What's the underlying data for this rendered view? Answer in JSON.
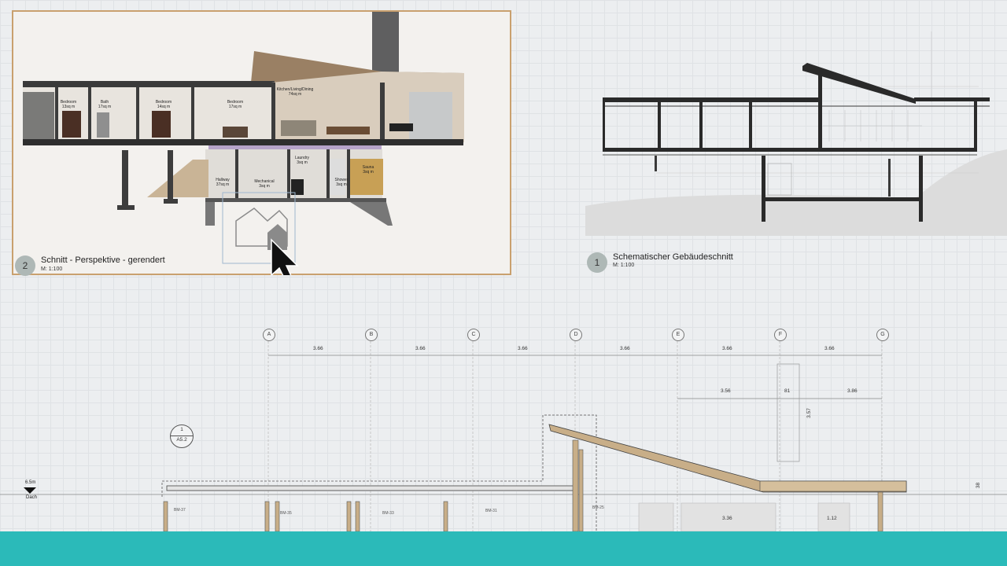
{
  "viewport_rendered": {
    "number": "2",
    "title": "Schnitt - Perspektive - gerendert",
    "scale": "M: 1:100",
    "rooms": [
      {
        "name": "Bedroom",
        "area": "13sq m"
      },
      {
        "name": "Bath",
        "area": "17sq m"
      },
      {
        "name": "Bedroom",
        "area": "14sq m"
      },
      {
        "name": "Bedroom",
        "area": "17sq m"
      },
      {
        "name": "Kitchen/Living/Dining",
        "area": "74sq m"
      },
      {
        "name": "Hallway",
        "area": "37sq m"
      },
      {
        "name": "Mechanical",
        "area": "3sq m"
      },
      {
        "name": "Laundry",
        "area": "3sq m"
      },
      {
        "name": "Shower",
        "area": "3sq m"
      },
      {
        "name": "Sauna",
        "area": "3sq m"
      }
    ]
  },
  "viewport_schematic": {
    "number": "1",
    "title": "Schematischer Gebäudeschnitt",
    "scale": "M: 1:100"
  },
  "gridlines": [
    "A",
    "B",
    "C",
    "D",
    "E",
    "F",
    "G"
  ],
  "grid_dimensions": [
    "3.66",
    "3.66",
    "3.66",
    "3.66",
    "3.66",
    "3.66"
  ],
  "sub_dimensions": {
    "left": "3.56",
    "mid": "81",
    "right": "3.86",
    "vertical": "3.57",
    "height": "38"
  },
  "bottom_dimensions": {
    "a": "3.36",
    "b": "1.12"
  },
  "section_marker": {
    "number": "1",
    "sheet": "A5.2"
  },
  "level": {
    "elevation": "6.5m",
    "name": "Dach"
  },
  "beams": [
    "BM-37",
    "BM-35",
    "BM-33",
    "BM-31",
    "BM-25"
  ],
  "colors": {
    "frame": "#c9a06e",
    "accent": "#2bbab9",
    "roof_wood": "#c8ae88"
  },
  "cursor_icon": "arrow-cursor-icon",
  "drag_icon": "house-drag-icon"
}
